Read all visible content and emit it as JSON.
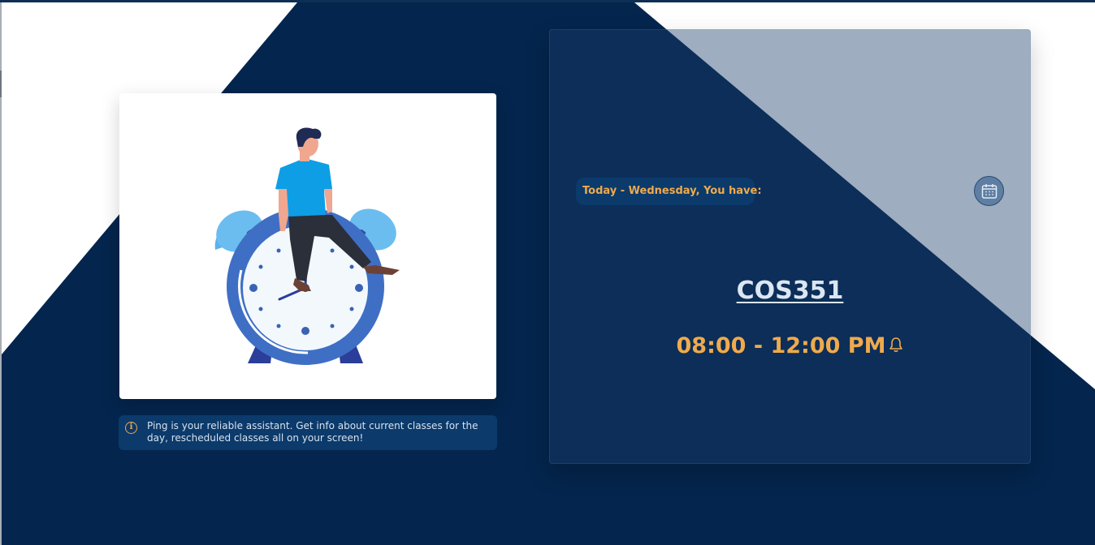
{
  "illustration": {
    "alt": "person sitting on alarm clock"
  },
  "info": {
    "icon": "info-icon",
    "text": "Ping is your reliable assistant. Get info about current classes for the day, rescheduled classes all on your screen!"
  },
  "schedule": {
    "today_label": "Today - Wednesday, You have:",
    "calendar_icon": "calendar-icon",
    "course_code": "COS351",
    "time": "08:00 - 12:00 PM",
    "bell_icon": "bell-icon"
  },
  "colors": {
    "background_navy": "#04254d",
    "accent_orange": "#f0aa4c",
    "panel_white": "#ffffff"
  }
}
